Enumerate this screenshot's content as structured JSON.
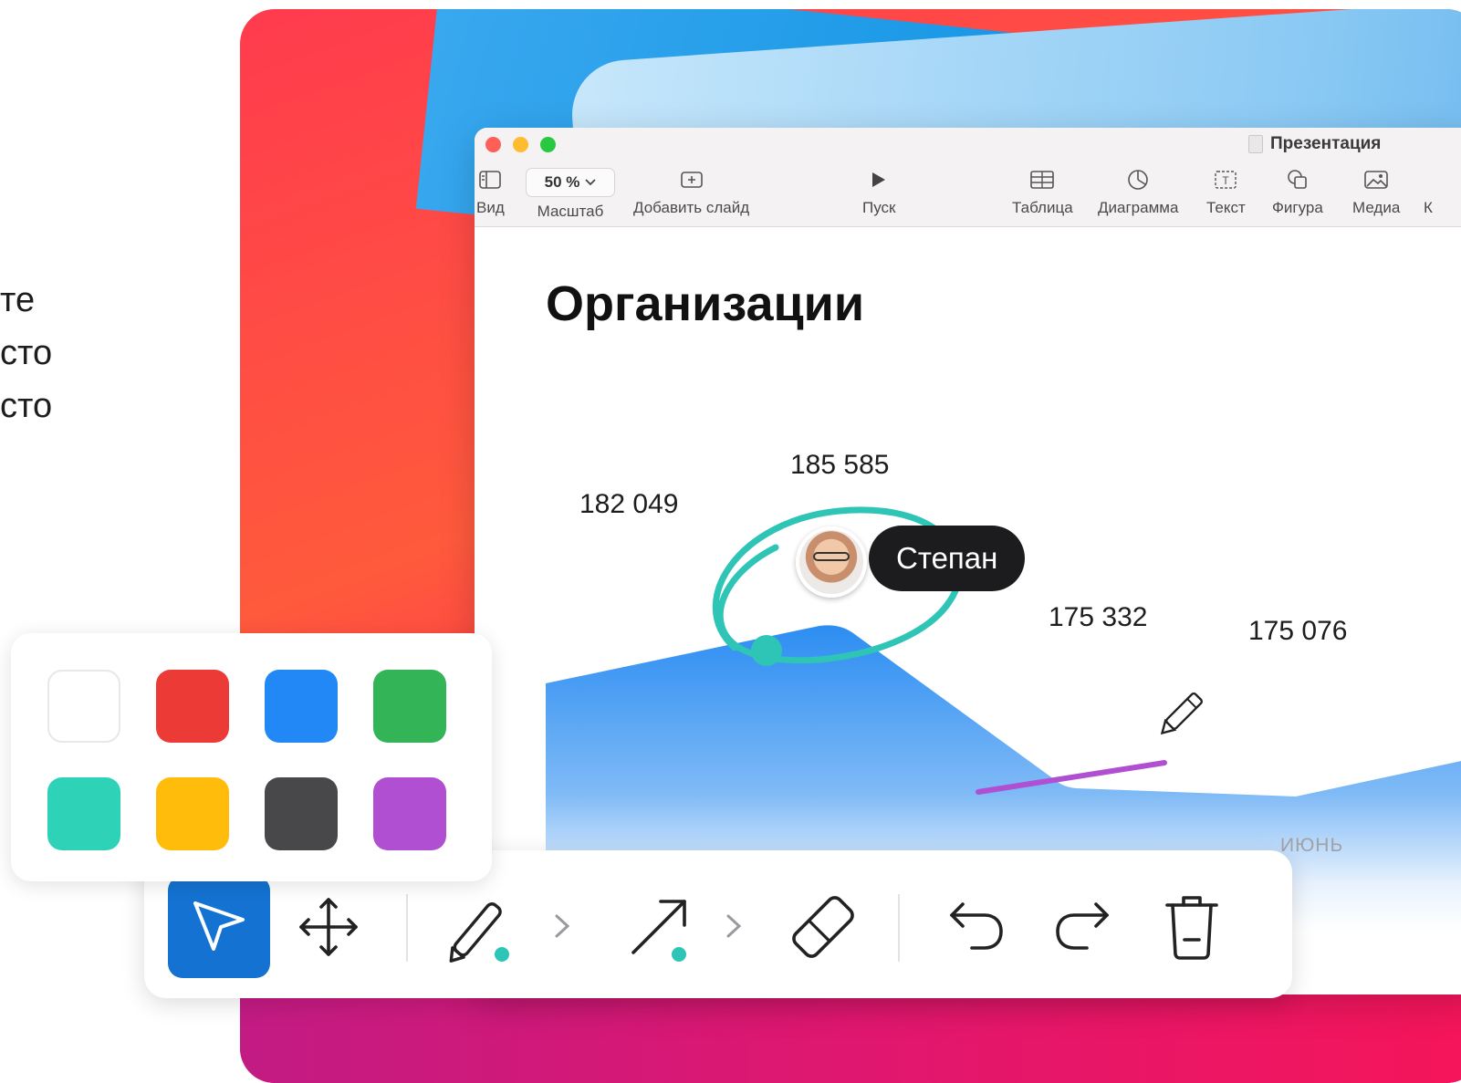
{
  "left_text": [
    "те",
    "сто",
    "сто"
  ],
  "window": {
    "title": "Презентация",
    "toolbar": [
      {
        "id": "view",
        "label": "Вид",
        "icon": "sidebar-icon"
      },
      {
        "id": "zoom",
        "label": "Масштаб",
        "value": "50 %",
        "icon": "chevron-down-icon"
      },
      {
        "id": "add_slide",
        "label": "Добавить слайд",
        "icon": "add-slide-icon"
      },
      {
        "id": "play",
        "label": "Пуск",
        "icon": "play-icon"
      },
      {
        "id": "table",
        "label": "Таблица",
        "icon": "table-icon"
      },
      {
        "id": "chart",
        "label": "Диаграмма",
        "icon": "chart-icon"
      },
      {
        "id": "text",
        "label": "Текст",
        "icon": "text-box-icon"
      },
      {
        "id": "shape",
        "label": "Фигура",
        "icon": "shape-icon"
      },
      {
        "id": "media",
        "label": "Медиа",
        "icon": "media-icon"
      },
      {
        "id": "cut",
        "label": "К"
      }
    ]
  },
  "slide": {
    "title": "Организации",
    "chart": {
      "value_labels": [
        "182 049",
        "185 585",
        "175 332",
        "175 076"
      ],
      "month_label": "ИЮНЬ"
    }
  },
  "collaborator": {
    "name": "Степан"
  },
  "palette": {
    "colors": [
      "#ffffff",
      "#ec3a36",
      "#2188f5",
      "#33b456",
      "#2ed3b7",
      "#ffbc0a",
      "#48484a",
      "#b04fd1"
    ]
  },
  "draw_toolbar": {
    "tools": [
      "select",
      "move",
      "pen",
      "arrow",
      "eraser",
      "undo",
      "redo",
      "delete"
    ],
    "active": "select",
    "active_color": "#1473d2",
    "pen_color": "#2ec4b6"
  }
}
